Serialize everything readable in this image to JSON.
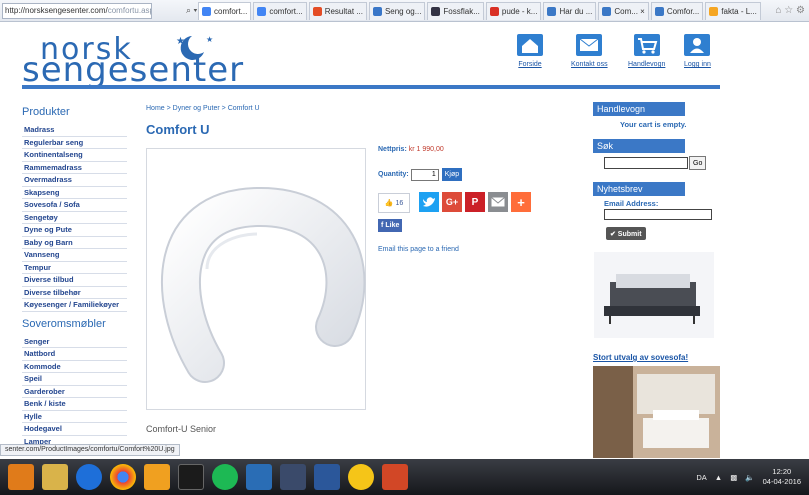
{
  "browser": {
    "url_main": "http://norsksengesenter.com/",
    "url_rest": "comfortu.aspx",
    "controls": "⌕ ▾ C",
    "tabs": [
      {
        "label": "comfort...",
        "color": "#4285f4",
        "active": true
      },
      {
        "label": "comfort...",
        "color": "#4285f4",
        "active": false
      },
      {
        "label": "Resultat ...",
        "color": "#e44d26",
        "active": false
      },
      {
        "label": "Seng og...",
        "color": "#3a77c8",
        "active": false
      },
      {
        "label": "Fossflak...",
        "color": "#334",
        "active": false
      },
      {
        "label": "pude - k...",
        "color": "#d93025",
        "active": false
      },
      {
        "label": "Har du ...",
        "color": "#3b78c6",
        "active": false
      },
      {
        "label": "Com... ×",
        "color": "#3b78c6",
        "active": false
      },
      {
        "label": "Comfor...",
        "color": "#3b78c6",
        "active": false
      },
      {
        "label": "fakta - L...",
        "color": "#f5a623",
        "active": false
      }
    ],
    "tools": "⌂ ☆ ⚙"
  },
  "logo": {
    "line1": "norsk",
    "line2": "sengesenter"
  },
  "topnav": [
    {
      "label": "Forside",
      "icon": "home-icon"
    },
    {
      "label": "Kontakt oss",
      "icon": "mail-icon"
    },
    {
      "label": "Handlevogn",
      "icon": "cart-icon"
    },
    {
      "label": "Logg inn",
      "icon": "user-icon"
    }
  ],
  "sidebar": {
    "products_title": "Produkter",
    "products": [
      "Madrass",
      "Regulerbar seng",
      "Kontinentalseng",
      "Rammemadrass",
      "Overmadrass",
      "Skapseng",
      "Sovesofa / Sofa",
      "Sengetøy",
      "Dyne og Pute",
      "Baby og Barn",
      "Vannseng",
      "Tempur",
      "Diverse tilbud",
      "Diverse tilbehør",
      "Køyesenger / Familiekøyer"
    ],
    "furniture_title": "Soveromsmøbler",
    "furniture": [
      "Senger",
      "Nattbord",
      "Kommode",
      "Speil",
      "Garderober",
      "Benk / kiste",
      "Hylle",
      "Hodegavel",
      "Lamper"
    ]
  },
  "main": {
    "breadcrumb": "Home > Dyner og Puter > Comfort U",
    "title": "Comfort U",
    "price_label": "Nettpris:",
    "price_value": "kr 1 990,00",
    "quantity_label": "Quantity:",
    "quantity_value": "1",
    "buy_label": "Kjøp",
    "like_count": "16",
    "fb_like": "Like",
    "email_friend": "Email this page to a friend",
    "caption": "Comfort-U Senior"
  },
  "right": {
    "cart_title": "Handlevogn",
    "cart_empty": "Your cart is empty.",
    "search_title": "Søk",
    "go_label": "Go",
    "newsletter_title": "Nyhetsbrev",
    "email_label": "Email Address:",
    "submit_label": "✔ Submit",
    "sofa_link": "Stort utvalg av sovesofa!"
  },
  "status_url": "senter.com/ProductImages/comfortu/Comfort%20U.jpg",
  "taskbar": {
    "lang": "DA",
    "time": "12:20",
    "date": "04-04-2016"
  },
  "colors": {
    "brand": "#2b69b3",
    "bar": "#3b78c6",
    "price": "#c0392b"
  }
}
